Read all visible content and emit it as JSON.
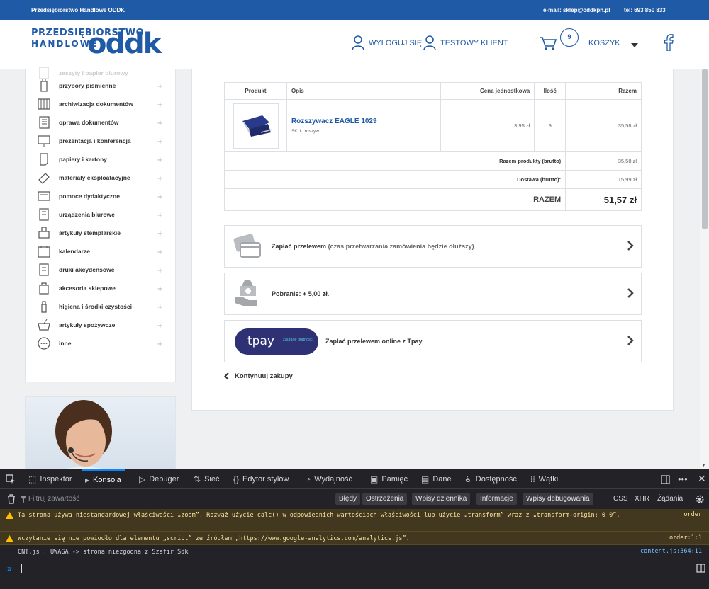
{
  "topbar": {
    "brand": "Przedsiębiorstwo Handlowe ODDK",
    "email": "e-mail: sklep@oddkph.pl",
    "phone": "tel: 693 850 833"
  },
  "header": {
    "logo_line1": "PRZEDSIĘBIORSTWO",
    "logo_line2": "HANDLOWE",
    "logo_mark": "oddk",
    "logout_label": "WYLOGUJ SIĘ",
    "account_label": "TESTOWY KLIENT",
    "cart_count": "9",
    "cart_label": "KOSZYK",
    "colors": {
      "brand": "#1f5aa6"
    }
  },
  "sidebar": {
    "items": [
      {
        "label": "zeszyty i papier biurowy",
        "icon": "notebook-icon"
      },
      {
        "label": "przybory piśmienne",
        "icon": "pen-icon"
      },
      {
        "label": "archiwizacja dokumentów",
        "icon": "archive-icon"
      },
      {
        "label": "oprawa dokumentów",
        "icon": "binder-icon"
      },
      {
        "label": "prezentacja i konferencja",
        "icon": "board-icon"
      },
      {
        "label": "papiery i kartony",
        "icon": "paper-icon"
      },
      {
        "label": "materiały eksploatacyjne",
        "icon": "cartridge-icon"
      },
      {
        "label": "pomoce dydaktyczne",
        "icon": "teaching-icon"
      },
      {
        "label": "urządzenia biurowe",
        "icon": "device-icon"
      },
      {
        "label": "artykuły stemplarskie",
        "icon": "stamp-icon"
      },
      {
        "label": "kalendarze",
        "icon": "calendar-icon"
      },
      {
        "label": "druki akcydensowe",
        "icon": "forms-icon"
      },
      {
        "label": "akcesoria sklepowe",
        "icon": "bag-icon"
      },
      {
        "label": "higiena i środki czystości",
        "icon": "bottle-icon"
      },
      {
        "label": "artykuły spożywcze",
        "icon": "basket-icon"
      },
      {
        "label": "inne",
        "icon": "more-icon"
      }
    ],
    "expand_symbol": "+"
  },
  "order": {
    "headers": [
      "Produkt",
      "Opis",
      "Cena jednostkowa",
      "Ilość",
      "Razem"
    ],
    "item": {
      "name": "Rozszywacz EAGLE 1029",
      "sku": "SKU : roszyw",
      "unit_price": "3,95 zł",
      "qty": "9",
      "total": "35,58 zł"
    },
    "products_label": "Razem produkty (brutto)",
    "products_value": "35,58 zł",
    "delivery_label": "Dostawa (brutto):",
    "delivery_value": "15,99 zł",
    "total_label": "RAZEM",
    "total_value": "51,57 zł"
  },
  "payment": {
    "transfer_label": "Zapłać przelewem",
    "transfer_note": "(czas przetwarzania zamówienia będzie dłuższy)",
    "cod_label": "Pobranie: + 5,00 zł.",
    "tpay_logo": "tpay",
    "tpay_tag": "zaufane płatności",
    "tpay_label": "Zapłać przelewem online z Tpay"
  },
  "continue_label": "Kontynuuj zakupy",
  "devtools": {
    "tabs": [
      {
        "label": "Inspektor",
        "icon": "inspector-icon",
        "glyph": "⬚"
      },
      {
        "label": "Konsola",
        "icon": "console-icon",
        "glyph": "▸"
      },
      {
        "label": "Debuger",
        "icon": "debugger-icon",
        "glyph": "▷"
      },
      {
        "label": "Sieć",
        "icon": "network-icon",
        "glyph": "⇅"
      },
      {
        "label": "Edytor stylów",
        "icon": "style-editor-icon",
        "glyph": "{}"
      },
      {
        "label": "Wydajność",
        "icon": "performance-icon",
        "glyph": "◔"
      },
      {
        "label": "Pamięć",
        "icon": "memory-icon",
        "glyph": "▣"
      },
      {
        "label": "Dane",
        "icon": "storage-icon",
        "glyph": "▤"
      },
      {
        "label": "Dostępność",
        "icon": "accessibility-icon",
        "glyph": "♿"
      },
      {
        "label": "Wątki",
        "icon": "workers-icon",
        "glyph": "⁞⁞"
      }
    ],
    "active_tab": "Konsola",
    "filter_placeholder": "Filtruj zawartość",
    "filter_buttons": [
      "Błędy",
      "Ostrzeżenia",
      "Wpisy dziennika",
      "Informacje",
      "Wpisy debugowania"
    ],
    "filter_text": [
      "CSS",
      "XHR",
      "Żądania"
    ],
    "messages": [
      {
        "type": "warn",
        "text": "Ta strona używa niestandardowej właściwości „zoom”. Rozważ użycie calc() w odpowiednich wartościach właściwości lub użycie „transform” wraz z „transform-origin: 0 0”.",
        "source": "order"
      },
      {
        "type": "warn",
        "text": "Wczytanie się nie powiodło dla elementu „script” ze źródłem „https://www.google-analytics.com/analytics.js”.",
        "source": "order:1:1"
      },
      {
        "type": "log",
        "text": "CNT.js : UWAGA -> strona niezgodna z Szafir Sdk",
        "source": "content.js:364:11"
      }
    ],
    "prompt": "»",
    "colors": {
      "accent": "#0a84ff",
      "warn_bg": "#42381f"
    }
  }
}
